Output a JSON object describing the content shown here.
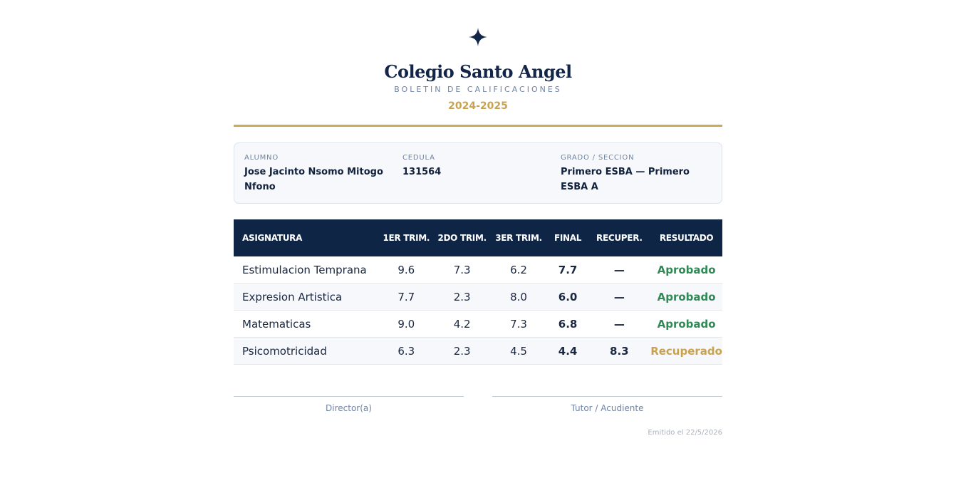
{
  "header": {
    "crest_icon": "four-point-star-icon",
    "school_name": "Colegio Santo Angel",
    "document_type": "BOLETIN DE CALIFICACIONES",
    "school_year": "2024-2025"
  },
  "student": {
    "name_label": "ALUMNO",
    "name": "Jose Jacinto Nsomo Mitogo Nfono",
    "id_label": "CEDULA",
    "id": "131564",
    "grade_label": "GRADO / SECCION",
    "grade": "Primero ESBA — Primero ESBA A"
  },
  "table": {
    "headers": {
      "subject": "ASIGNATURA",
      "t1": "1ER TRIM.",
      "t2": "2DO TRIM.",
      "t3": "3ER TRIM.",
      "final": "FINAL",
      "recovery": "RECUPER.",
      "result": "RESULTADO"
    },
    "rows": [
      {
        "subject": "Estimulacion Temprana",
        "t1": "9.6",
        "t2": "7.3",
        "t3": "6.2",
        "final": "7.7",
        "final_status": "pass",
        "recovery": "—",
        "result": "Aprobado",
        "result_status": "pass"
      },
      {
        "subject": "Expresion Artistica",
        "t1": "7.7",
        "t2": "2.3",
        "t3": "8.0",
        "final": "6.0",
        "final_status": "pass",
        "recovery": "—",
        "result": "Aprobado",
        "result_status": "pass"
      },
      {
        "subject": "Matematicas",
        "t1": "9.0",
        "t2": "4.2",
        "t3": "7.3",
        "final": "6.8",
        "final_status": "pass",
        "recovery": "—",
        "result": "Aprobado",
        "result_status": "pass"
      },
      {
        "subject": "Psicomotricidad",
        "t1": "6.3",
        "t2": "2.3",
        "t3": "4.5",
        "final": "4.4",
        "final_status": "fail",
        "recovery": "8.3",
        "result": "Recuperado",
        "result_status": "recuperado"
      }
    ]
  },
  "signatures": {
    "director": "Director(a)",
    "tutor": "Tutor / Acudiente"
  },
  "footer": {
    "issued": "Emitido el 22/5/2026"
  },
  "colors": {
    "navy": "#0f2546",
    "gold": "#c9a24e",
    "pass_green": "#2f8a55",
    "fail_red": "#d7363c"
  }
}
